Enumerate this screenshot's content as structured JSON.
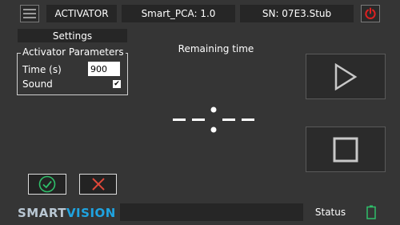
{
  "header": {
    "mode": "ACTIVATOR",
    "model": "Smart_PCA: 1.0",
    "serial": "SN: 07E3.Stub"
  },
  "settings": {
    "title": "Settings",
    "group_title": "Activator Parameters",
    "time_label": "Time (s)",
    "time_value": "900",
    "sound_label": "Sound",
    "sound_checked": true
  },
  "timer": {
    "label": "Remaining time",
    "display": "--:--"
  },
  "footer": {
    "logo_smart": "SMART",
    "logo_vision": "VISION",
    "status_label": "Status",
    "status_text": ""
  },
  "icons": {
    "menu": "hamburger-menu-icon",
    "power": "power-icon",
    "play": "play-icon",
    "stop": "stop-icon",
    "confirm": "check-icon",
    "cancel": "close-icon",
    "battery": "battery-icon"
  },
  "colors": {
    "background": "#353535",
    "bar": "#262626",
    "power": "#e02020",
    "confirm": "#2fbf6a",
    "cancel": "#e0483a",
    "logo_smart": "#b9c7d3",
    "logo_vision": "#1fa3e0",
    "battery": "#2fbf6a"
  }
}
